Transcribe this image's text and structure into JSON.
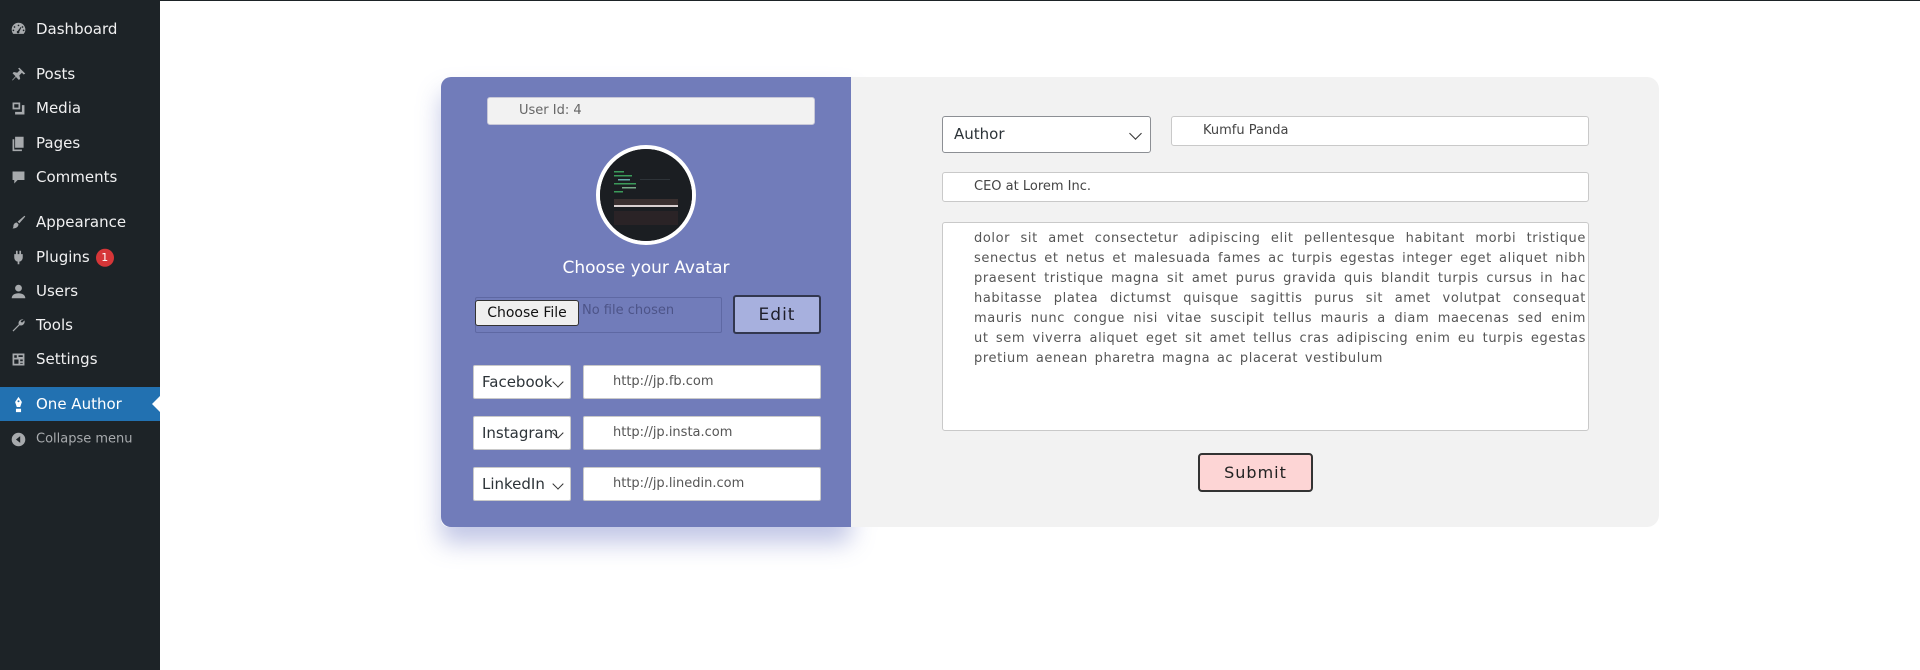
{
  "sidebar": {
    "items": [
      {
        "label": "Dashboard",
        "icon": "dashboard-icon"
      },
      {
        "label": "Posts",
        "icon": "pin-icon"
      },
      {
        "label": "Media",
        "icon": "media-icon"
      },
      {
        "label": "Pages",
        "icon": "pages-icon"
      },
      {
        "label": "Comments",
        "icon": "comment-icon"
      },
      {
        "label": "Appearance",
        "icon": "brush-icon"
      },
      {
        "label": "Plugins",
        "icon": "plug-icon",
        "badge": "1"
      },
      {
        "label": "Users",
        "icon": "user-icon"
      },
      {
        "label": "Tools",
        "icon": "wrench-icon"
      },
      {
        "label": "Settings",
        "icon": "settings-icon"
      },
      {
        "label": "One Author",
        "icon": "pen-icon",
        "active": true
      }
    ],
    "collapse_label": "Collapse menu"
  },
  "profile": {
    "user_id": "User Id: 4",
    "avatar_label": "Choose your Avatar",
    "file_button": "Choose File",
    "file_status": "No file chosen",
    "edit_label": "Edit",
    "socials": [
      {
        "network": "Facebook",
        "url": "http://jp.fb.com"
      },
      {
        "network": "Instagram",
        "url": "http://jp.insta.com"
      },
      {
        "network": "LinkedIn",
        "url": "http://jp.linedin.com"
      }
    ]
  },
  "details": {
    "role": "Author",
    "name": "Kumfu Panda",
    "title": "CEO at Lorem Inc.",
    "bio": "dolor sit amet consectetur adipiscing elit pellentesque habitant morbi tristique senectus et netus et malesuada fames ac turpis egestas integer eget aliquet nibh praesent tristique magna sit amet purus gravida quis blandit turpis cursus in hac habitasse platea dictumst quisque sagittis purus sit amet volutpat consequat mauris nunc congue nisi vitae suscipit tellus mauris a diam maecenas sed enim ut sem viverra aliquet eget sit amet tellus cras adipiscing enim eu turpis egestas pretium aenean pharetra magna ac placerat vestibulum",
    "submit_label": "Submit"
  },
  "colors": {
    "sidebar_bg": "#1d2327",
    "active_item": "#2271b1",
    "profile_panel": "#717cba",
    "form_panel": "#f2f2f2",
    "submit_bg": "#fdd5d5",
    "badge": "#d63638"
  }
}
